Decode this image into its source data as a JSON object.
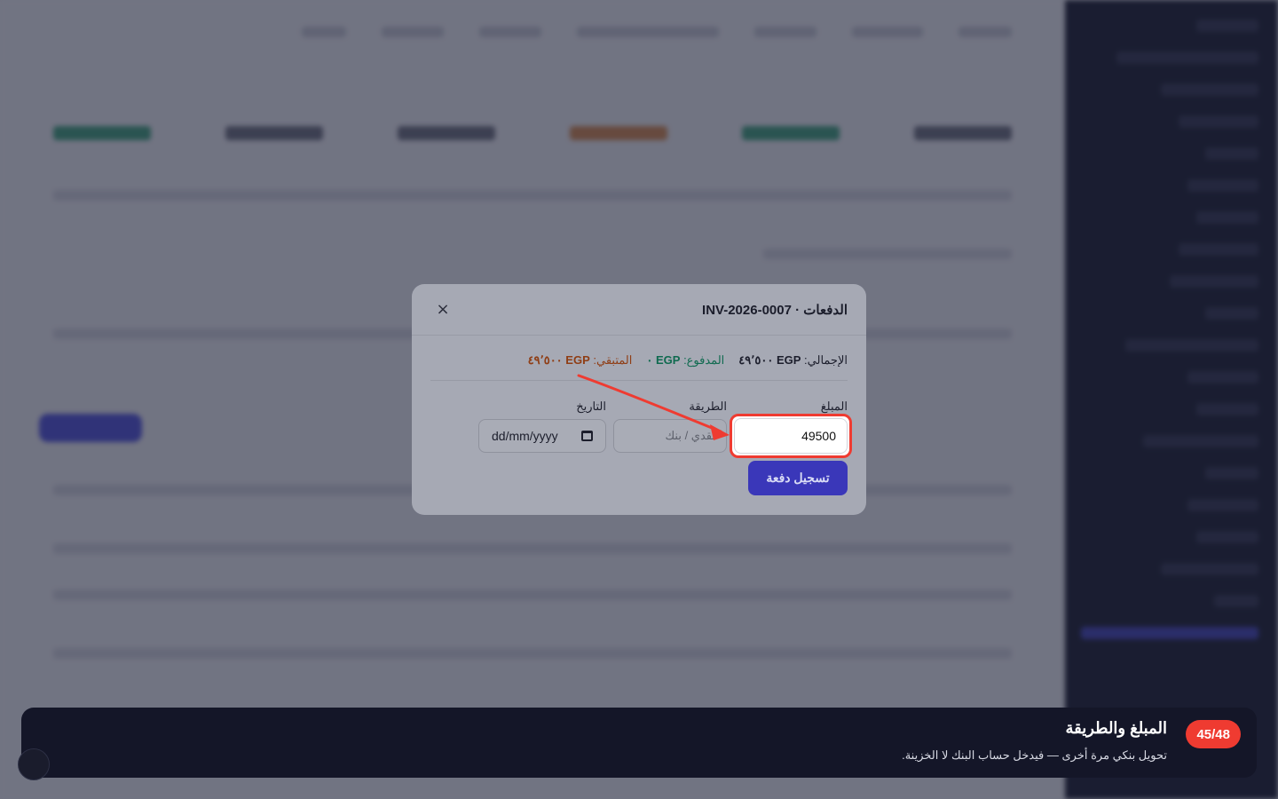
{
  "modal": {
    "title": "الدفعات · INV-2026-0007",
    "close_symbol": "×",
    "summary": {
      "total_label": "الإجمالي:",
      "total_value": "EGP ٤٩٬٥٠٠",
      "paid_label": "المدفوع:",
      "paid_value": "EGP ٠",
      "remaining_label": "المتبقي:",
      "remaining_value": "EGP ٤٩٬٥٠٠"
    },
    "fields": {
      "amount_label": "المبلغ",
      "amount_value": "49500",
      "method_label": "الطريقة",
      "method_placeholder": "نقدي / بنك",
      "date_label": "التاريخ",
      "date_placeholder": "dd/mm/yyyy"
    },
    "submit_label": "تسجيل دفعة"
  },
  "tour": {
    "step": "45/48",
    "title": "المبلغ والطريقة",
    "description": "تحويل بنكي مرة أخرى — فيدخل حساب البنك لا الخزينة."
  },
  "colors": {
    "highlight": "#ef3b31",
    "primary": "#3a37b9",
    "paid": "#0f6a4f",
    "remaining": "#8f3d14"
  },
  "icons": {
    "close": "close-icon",
    "calendar": "calendar-icon",
    "arrow": "pointer-arrow-icon"
  }
}
